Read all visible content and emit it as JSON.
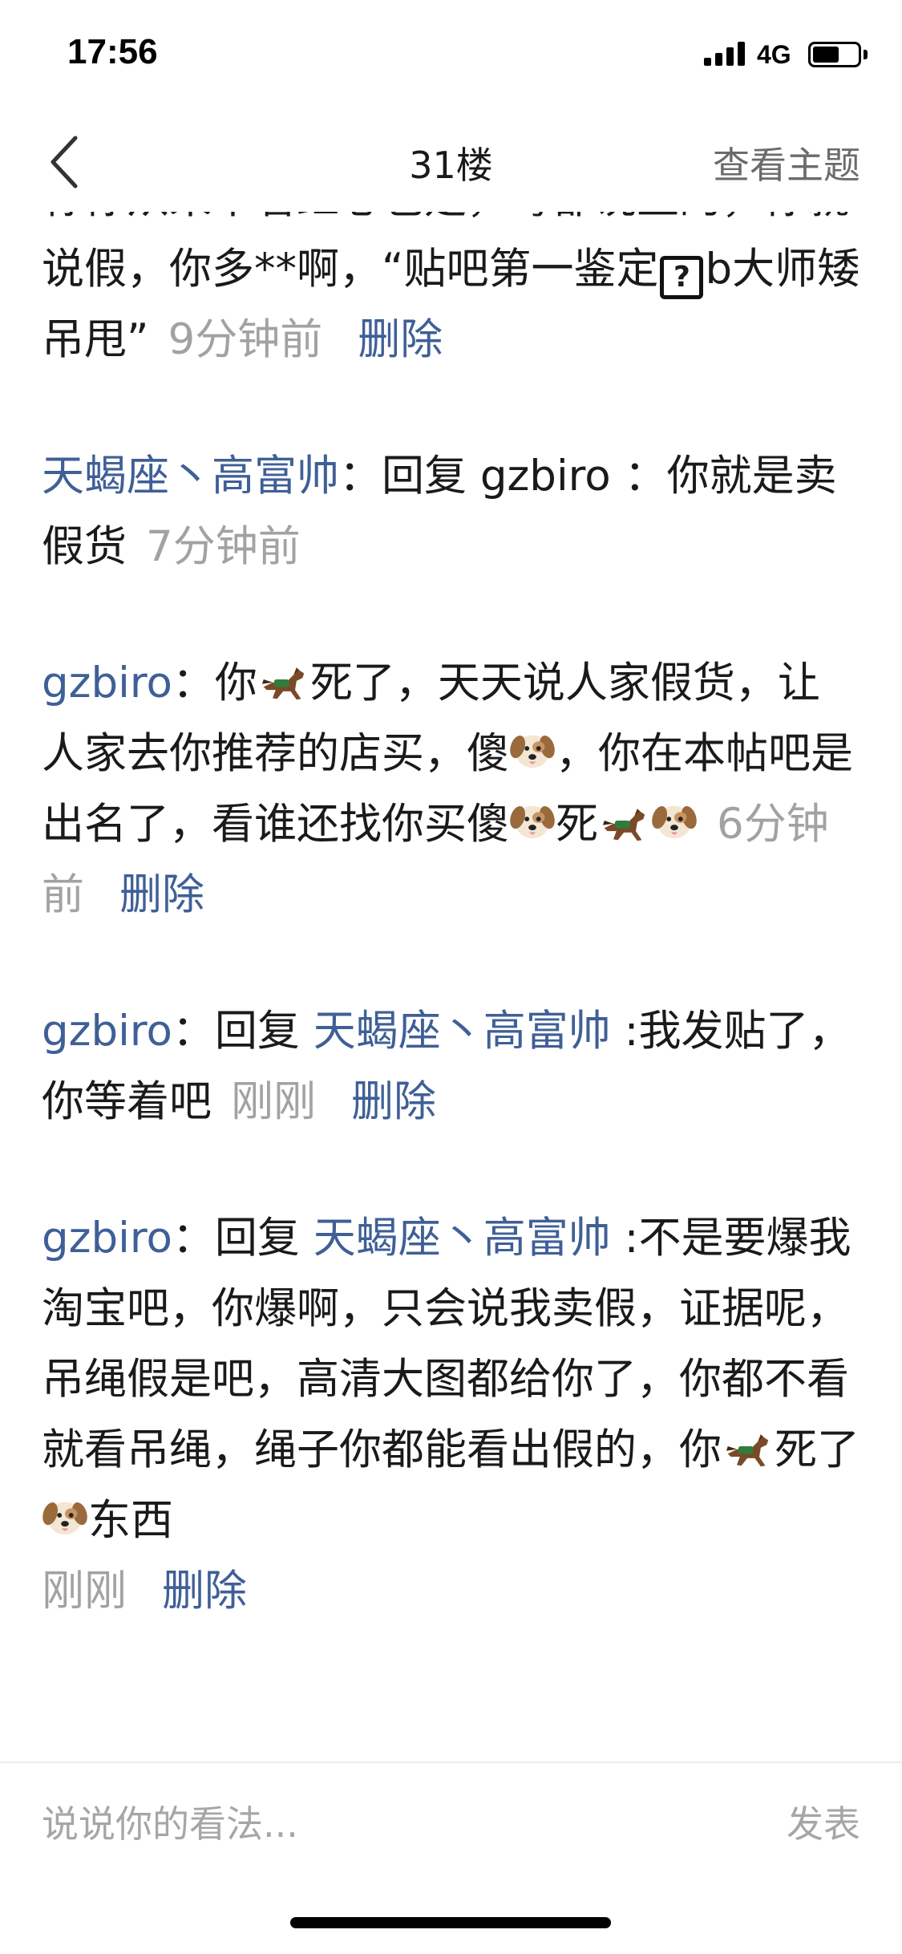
{
  "status_bar": {
    "time": "17:56",
    "network": "4G",
    "battery_level": 0.6
  },
  "nav": {
    "title": "31楼",
    "view_topic": "查看主题"
  },
  "comments": {
    "c0": {
      "line0": "称你从来不看红心也是，每都说正",
      "text_a": "的，你就说假，你多**啊，“贴吧第一鉴定",
      "qbox": "?",
      "text_b": "b大师矮吊甩”",
      "time": "9分钟前",
      "delete": "删除"
    },
    "c1": {
      "user": "天蝎座丶高富帅",
      "colon": "：",
      "text": "回复 gzbiro ：你就是卖假货",
      "time": "7分钟前"
    },
    "c2": {
      "user": "gzbiro",
      "colon": "：",
      "t1": "你",
      "t2": "死了，天天说人家假货，让人家去你推荐的店买，傻",
      "t3": "，你在本帖吧是出名了，看谁还找你买傻",
      "t4": "死",
      "time": "6分钟前",
      "delete": "删除"
    },
    "c3": {
      "user": "gzbiro",
      "colon": "：",
      "reply": "回复 ",
      "target": "天蝎座丶高富帅",
      "text": " :我发贴了，你等着吧",
      "time": "刚刚",
      "delete": "删除"
    },
    "c4": {
      "user": "gzbiro",
      "colon": "：",
      "reply": "回复 ",
      "target": "天蝎座丶高富帅",
      "text": " :不是要爆我淘宝吧，你爆啊，只会说我卖假，证据呢，吊绳假是吧，高清大图都给你了，你都不看就看吊绳，绳子你都能看出假的，你",
      "t2": "死了",
      "t3": "东西",
      "time": "刚刚",
      "delete": "删除"
    }
  },
  "input": {
    "placeholder": "说说你的看法...",
    "send": "发表"
  }
}
